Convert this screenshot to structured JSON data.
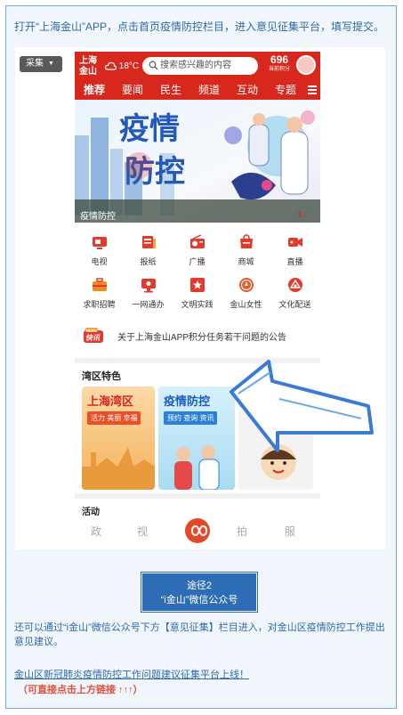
{
  "intro": "打开“上海金山”APP，点击首页疫情防控栏目，进入意见征集平台，填写提交。",
  "collect_button": "采集",
  "app": {
    "logo": [
      "上海",
      "金山"
    ],
    "weather": "18°C",
    "search_placeholder": "搜索感兴趣的内容",
    "points_value": "696",
    "points_label": "当前积分",
    "tabs": [
      "推荐",
      "要闻",
      "民生",
      "频道",
      "互动",
      "专题"
    ],
    "banner": {
      "title_line1": "疫情",
      "title_line2": "防控",
      "caption": "疫情防控",
      "page_current": "1",
      "page_total": "/7"
    },
    "grid": [
      {
        "label": "电视",
        "icon": "tv-icon"
      },
      {
        "label": "报纸",
        "icon": "newspaper-icon"
      },
      {
        "label": "广播",
        "icon": "radio-icon"
      },
      {
        "label": "商城",
        "icon": "mall-icon"
      },
      {
        "label": "直播",
        "icon": "live-icon"
      },
      {
        "label": "求职招聘",
        "icon": "job-icon"
      },
      {
        "label": "一网通办",
        "icon": "service-icon"
      },
      {
        "label": "文明实践",
        "icon": "star-icon"
      },
      {
        "label": "金山女性",
        "icon": "women-icon"
      },
      {
        "label": "文化配送",
        "icon": "culture-icon"
      }
    ],
    "notice_badge_top": "NEWS",
    "notice_badge": "快讯",
    "notice_text": "关于上海金山APP积分任务若干问题的公告",
    "section_title": "湾区特色",
    "cards": [
      {
        "title": "上海湾区",
        "sub": "活力 美丽 幸福"
      },
      {
        "title": "疫情防控",
        "sub": "预约 查询 资讯"
      }
    ],
    "activity_title": "活动",
    "bottom_nav": [
      "政",
      "视",
      "拍",
      "服"
    ]
  },
  "way": {
    "line1": "途径2",
    "line2": "“i金山”微信公众号"
  },
  "paragraph2": "还可以通过“i金山”微信公众号下方【意见征集】栏目进入，对金山区疫情防控工作提出意见建议。",
  "link_text": "金山区新冠肺炎疫情防控工作问题建议征集平台上线！",
  "hint_text": "（可直接点击上方链接 ↑↑↑）",
  "colors": {
    "brand_red": "#d8281e",
    "page_blue": "#2f6aa8",
    "way_blue": "#2e6db5",
    "hint_red": "#e0503a"
  }
}
